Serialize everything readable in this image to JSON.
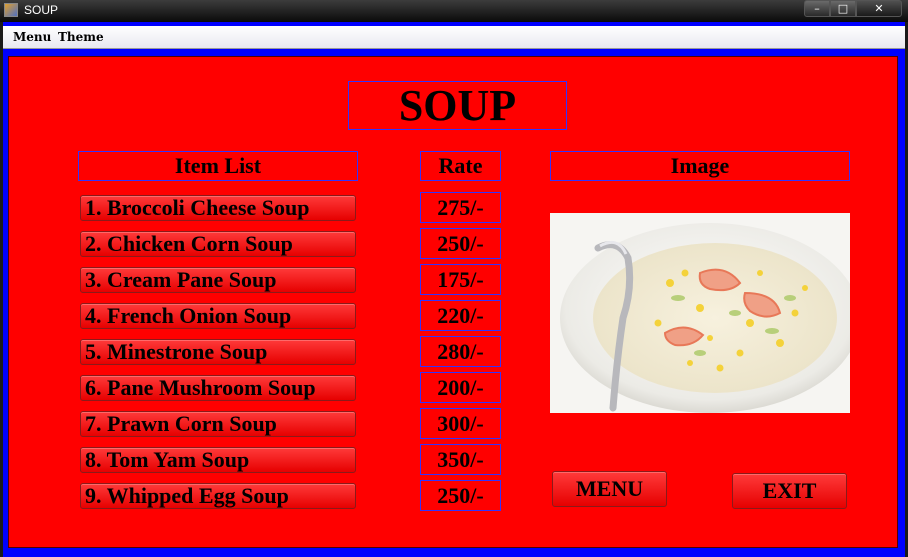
{
  "window": {
    "title": "SOUP",
    "controls": {
      "minimize": "–",
      "maximize": "□",
      "close": "✕"
    }
  },
  "menubar": {
    "items": [
      "Menu",
      "Theme"
    ]
  },
  "page": {
    "title": "SOUP"
  },
  "headers": {
    "items": "Item List",
    "rate": "Rate",
    "image": "Image"
  },
  "items": [
    {
      "name": "1. Broccoli Cheese Soup",
      "rate": "275/-"
    },
    {
      "name": "2. Chicken Corn Soup",
      "rate": "250/-"
    },
    {
      "name": "3. Cream Pane Soup",
      "rate": "175/-"
    },
    {
      "name": "4. French Onion Soup",
      "rate": "220/-"
    },
    {
      "name": "5. Minestrone Soup",
      "rate": "280/-"
    },
    {
      "name": "6. Pane Mushroom Soup",
      "rate": "200/-"
    },
    {
      "name": "7. Prawn Corn Soup",
      "rate": "300/-"
    },
    {
      "name": "8. Tom Yam Soup",
      "rate": "350/-"
    },
    {
      "name": "9. Whipped Egg Soup",
      "rate": "250/-"
    }
  ],
  "buttons": {
    "menu": "MENU",
    "exit": "EXIT"
  },
  "colors": {
    "panel": "#ff0000",
    "border": "#0000ff",
    "header_outline": "#3333ff"
  }
}
